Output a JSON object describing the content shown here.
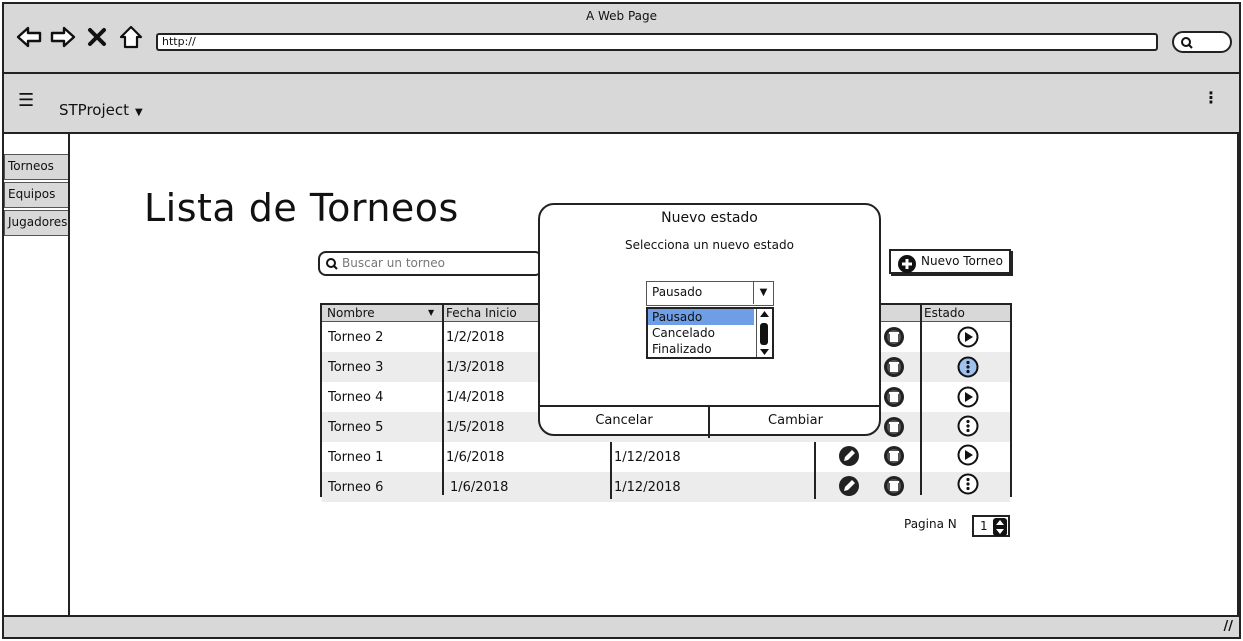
{
  "window": {
    "title": "A Web Page",
    "url": "http://"
  },
  "appbar": {
    "project": "STProject",
    "menu_icon": "hamburger-icon",
    "more_icon": "kebab-icon"
  },
  "sidebar": {
    "items": [
      {
        "label": "Torneos"
      },
      {
        "label": "Equipos"
      },
      {
        "label": "Jugadores"
      }
    ]
  },
  "main": {
    "title": "Lista de Torneos",
    "search_placeholder": "Buscar un torneo",
    "new_button": "Nuevo Torneo"
  },
  "table": {
    "headers": {
      "nombre": "Nombre",
      "fecha_inicio": "Fecha Inicio",
      "estado": "Estado"
    },
    "rows": [
      {
        "nombre": "Torneo 2",
        "inicio": "1/2/2018",
        "fin": "",
        "status_icon": "play-icon",
        "edit": false
      },
      {
        "nombre": "Torneo 3",
        "inicio": "1/3/2018",
        "fin": "",
        "status_icon": "more-icon",
        "edit": false
      },
      {
        "nombre": "Torneo 4",
        "inicio": "1/4/2018",
        "fin": "",
        "status_icon": "play-icon",
        "edit": false
      },
      {
        "nombre": "Torneo 5",
        "inicio": "1/5/2018",
        "fin": "",
        "status_icon": "more-icon",
        "edit": false
      },
      {
        "nombre": "Torneo 1",
        "inicio": "1/6/2018",
        "fin": "1/12/2018",
        "status_icon": "play-icon",
        "edit": true
      },
      {
        "nombre": "Torneo 6",
        "inicio": "1/6/2018",
        "fin": "1/12/2018",
        "status_icon": "more-icon",
        "edit": true
      }
    ]
  },
  "pager": {
    "label": "Pagina N",
    "value": "1"
  },
  "modal": {
    "title": "Nuevo estado",
    "subtitle": "Selecciona un nuevo estado",
    "selected": "Pausado",
    "options": [
      "Pausado",
      "Cancelado",
      "Finalizado"
    ],
    "cancel": "Cancelar",
    "confirm": "Cambiar"
  },
  "colors": {
    "chrome": "#d8d8d8",
    "selection": "#6d9ee6",
    "highlight_icon": "#9ec1f0"
  }
}
